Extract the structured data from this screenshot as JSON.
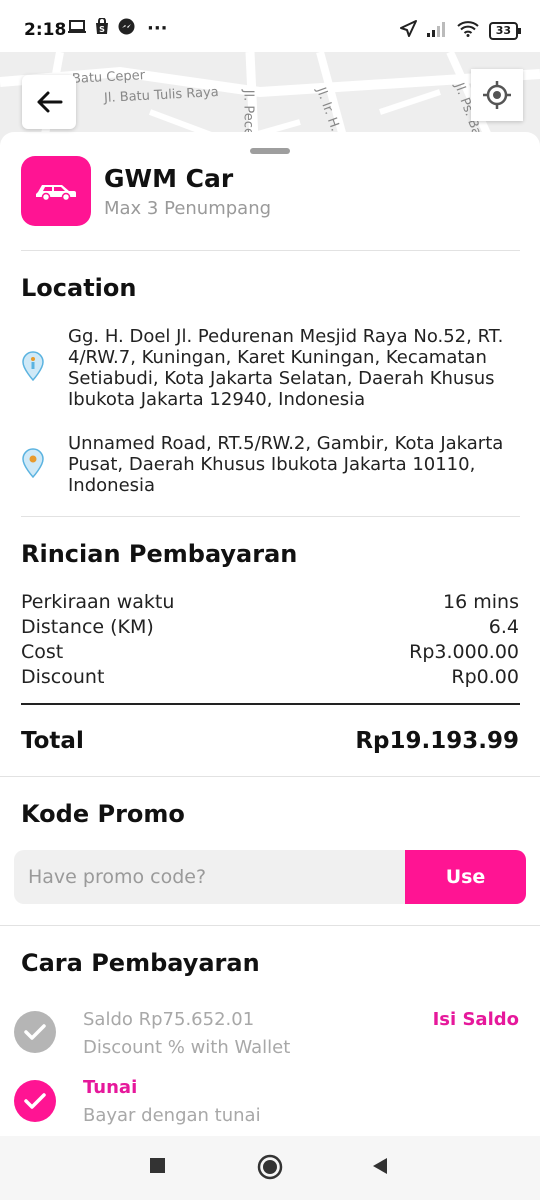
{
  "status_bar": {
    "time": "2:18",
    "battery": "33",
    "more": "···"
  },
  "map": {
    "labels": [
      "Batu Ceper",
      "Jl. Batu Tulis Raya",
      "Jl. Pecer",
      "Jl. Ir. H.",
      "Jl. Ps. Ba"
    ]
  },
  "vehicle": {
    "name": "GWM Car",
    "capacity": "Max 3 Penumpang"
  },
  "location": {
    "title": "Location",
    "pickup": "Gg. H. Doel Jl. Pedurenan Mesjid Raya No.52, RT. 4/RW.7, Kuningan, Karet Kuningan, Kecamatan Setiabudi, Kota Jakarta Selatan, Daerah Khusus Ibukota Jakarta 12940, Indonesia",
    "destination": "Unnamed Road, RT.5/RW.2, Gambir, Kota Jakarta Pusat, Daerah Khusus Ibukota Jakarta 10110, Indonesia"
  },
  "payment_details": {
    "title": "Rincian Pembayaran",
    "rows": [
      {
        "label": "Perkiraan waktu",
        "value": "16 mins"
      },
      {
        "label": "Distance (KM)",
        "value": "6.4"
      },
      {
        "label": "Cost",
        "value": "Rp3.000.00"
      },
      {
        "label": "Discount",
        "value": "Rp0.00"
      }
    ],
    "total_label": "Total",
    "total_value": "Rp19.193.99"
  },
  "promo": {
    "title": "Kode Promo",
    "placeholder": "Have promo code?",
    "button": "Use"
  },
  "payment_method": {
    "title": "Cara Pembayaran",
    "wallet_title": "Saldo Rp75.652.01",
    "wallet_sub": "Discount % with Wallet",
    "top_up": "Isi Saldo",
    "cash_title": "Tunai",
    "cash_sub": "Bayar dengan tunai"
  },
  "colors": {
    "accent": "#ff1493",
    "accent_text": "#e6189b",
    "muted": "#9a9a9a",
    "check_inactive": "#b5b5b5"
  }
}
